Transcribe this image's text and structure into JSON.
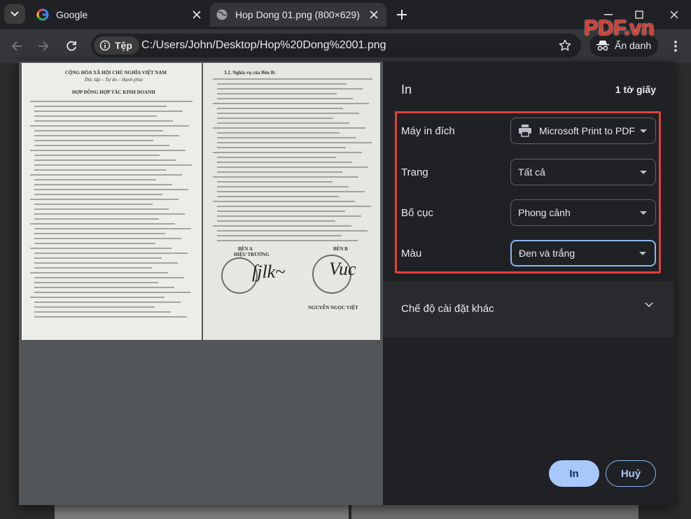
{
  "browser": {
    "tabs": [
      {
        "title": "Google",
        "icon": "google-icon",
        "active": false
      },
      {
        "title": "Hop Dong 01.png (800×629)",
        "icon": "globe-icon",
        "active": true
      }
    ],
    "address_bar": {
      "site_chip_label": "Tệp",
      "url": "C:/Users/John/Desktop/Hop%20Dong%2001.png"
    },
    "incognito_label": "Ẩn danh",
    "watermark": "PDF.vn"
  },
  "print_dialog": {
    "title": "In",
    "sheet_count": "1 tờ giấy",
    "settings": {
      "destination": {
        "label": "Máy in đích",
        "value": "Microsoft Print to PDF"
      },
      "pages": {
        "label": "Trang",
        "value": "Tất cả"
      },
      "layout": {
        "label": "Bố cục",
        "value": "Phong cảnh"
      },
      "color": {
        "label": "Màu",
        "value": "Đen và trắng"
      }
    },
    "more_settings_label": "Chế độ cài đặt khác",
    "print_button": "In",
    "cancel_button": "Huỷ"
  },
  "preview_document": {
    "left_heading": "CỘNG HÒA XÃ HỘI CHỦ NGHĨA VIỆT NAM",
    "left_subheading": "Độc lập – Tự do – Hạnh phúc",
    "contract_title": "HỢP ĐỒNG HỢP TÁC KINH DOANH",
    "right_heading": "3.2.  Nghĩa vụ của Bên B:",
    "party_a": "BÊN A",
    "party_a_role": "HIỆU TRƯỞNG",
    "party_b": "BÊN B",
    "party_b_signer": "NGUYỄN NGỌC VIỆT"
  },
  "colors": {
    "accent": "#8ab4f8",
    "highlight_border": "#e0403a",
    "dialog_bg": "#202124"
  }
}
